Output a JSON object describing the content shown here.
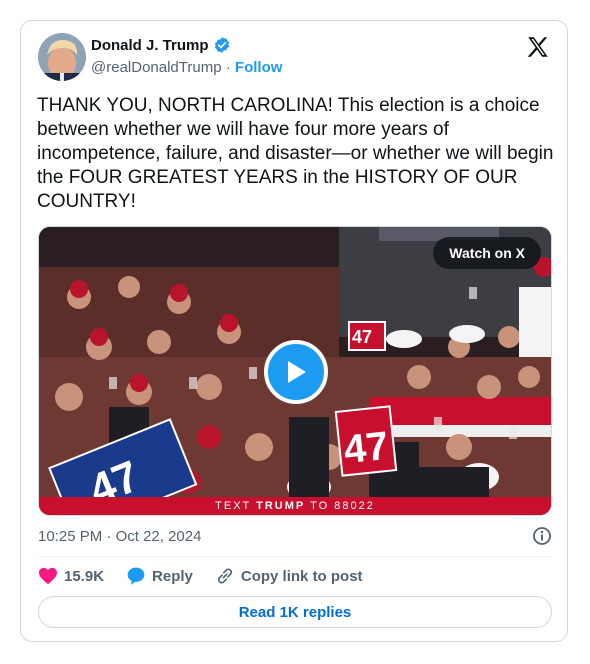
{
  "author": {
    "name": "Donald J. Trump",
    "handle": "@realDonaldTrump",
    "separator": "·",
    "follow_label": "Follow",
    "verified_color": "#1d9bf0"
  },
  "platform_icon": "x-logo-icon",
  "tweet": {
    "text": "THANK YOU, NORTH CAROLINA! This election is a choice between whether we will have four more years of incompetence, failure, and disaster—or whether we will begin the FOUR GREATEST YEARS in the HISTORY OF OUR COUNTRY!"
  },
  "media": {
    "watch_label": "Watch on X",
    "play_icon": "play-icon",
    "sign_number": "47",
    "banner_prefix": "TEXT ",
    "banner_keyword": "TRUMP",
    "banner_suffix": " TO 88022"
  },
  "meta": {
    "time": "10:25 PM",
    "separator": "·",
    "date": "Oct 22, 2024",
    "info_icon": "info-icon"
  },
  "actions": {
    "likes": "15.9K",
    "reply_label": "Reply",
    "copy_label": "Copy link to post"
  },
  "read_replies_label": "Read 1K replies",
  "colors": {
    "accent": "#1d9bf0",
    "like": "#f91880",
    "link": "#006fd6",
    "banner": "#c8102e"
  }
}
